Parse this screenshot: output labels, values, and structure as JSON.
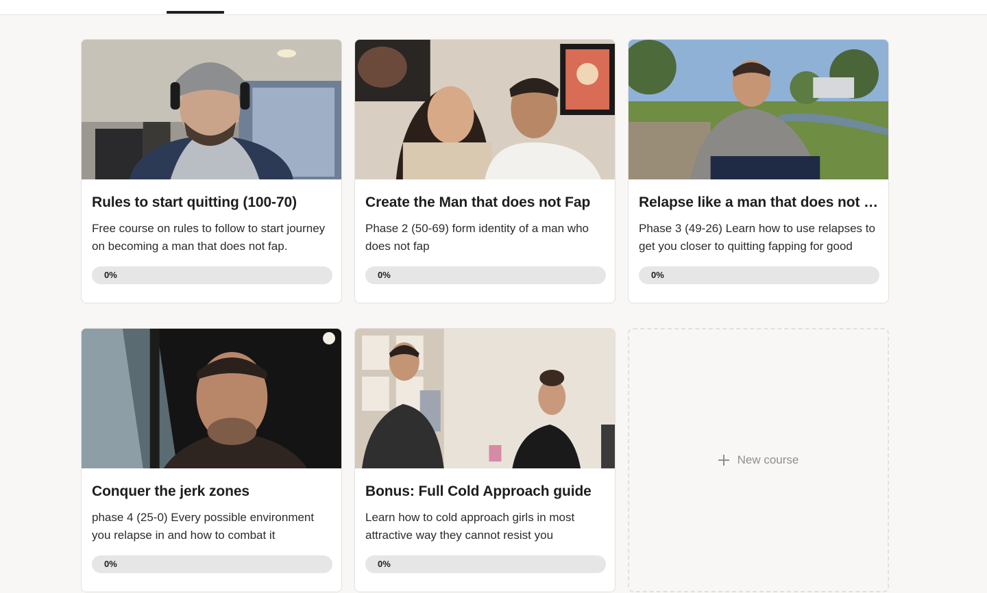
{
  "colors": {
    "page_bg": "#f8f7f5",
    "card_bg": "#ffffff",
    "progress_track": "#e6e6e6",
    "tab_indicator": "#1f1f1f",
    "muted_text": "#8e8e8e"
  },
  "courses": [
    {
      "title": "Rules to start quitting (100-70)",
      "description": "Free course on rules to follow to start journey on becoming a man that does not fap.",
      "progress_percent": 0,
      "progress_label": "0%"
    },
    {
      "title": "Create the Man that does not Fap",
      "description": "Phase 2 (50-69) form identity of a man who does not fap",
      "progress_percent": 0,
      "progress_label": "0%"
    },
    {
      "title": "Relapse like a man that does not f...",
      "description": "Phase 3 (49-26) Learn how to use relapses to get you closer to quitting fapping for good",
      "progress_percent": 0,
      "progress_label": "0%"
    },
    {
      "title": "Conquer the jerk zones",
      "description": "phase 4 (25-0) Every possible environment you relapse in and how to combat it",
      "progress_percent": 0,
      "progress_label": "0%"
    },
    {
      "title": "Bonus: Full Cold Approach guide",
      "description": "Learn how to cold approach girls in most attractive way they cannot resist you",
      "progress_percent": 0,
      "progress_label": "0%"
    }
  ],
  "new_course": {
    "label": "New course",
    "icon": "plus-icon"
  }
}
